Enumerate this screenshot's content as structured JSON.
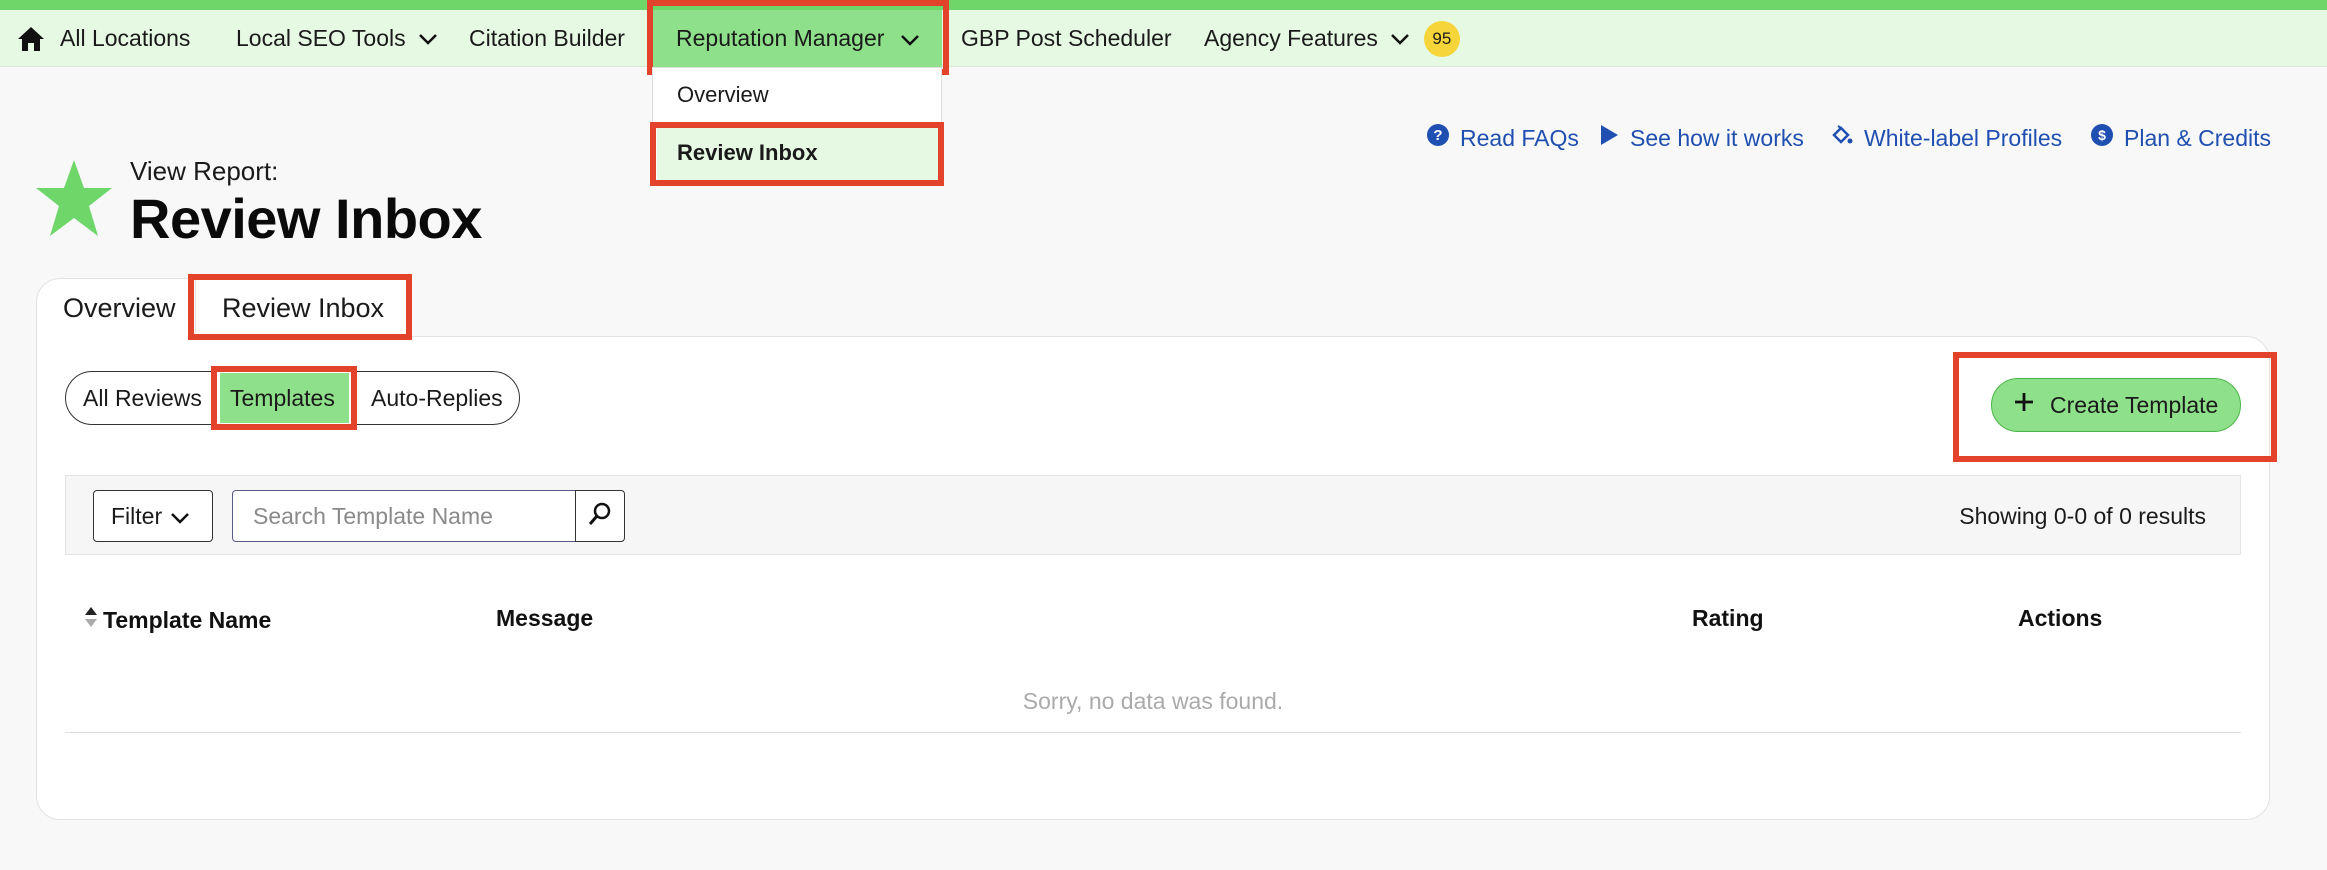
{
  "nav": {
    "home_label": "All Locations",
    "local_seo": "Local SEO Tools",
    "citation": "Citation Builder",
    "reputation": "Reputation Manager",
    "gbp": "GBP Post Scheduler",
    "agency": "Agency Features",
    "badge_count": "95"
  },
  "dropdown": {
    "items": [
      "Overview",
      "Review Inbox"
    ]
  },
  "help": {
    "faqs": "Read FAQs",
    "how": "See how it works",
    "whitelabel": "White-label Profiles",
    "plan": "Plan & Credits"
  },
  "header": {
    "subtitle": "View Report:",
    "title": "Review Inbox"
  },
  "tabs": [
    "Overview",
    "Review Inbox"
  ],
  "segments": [
    "All Reviews",
    "Templates",
    "Auto-Replies"
  ],
  "create_label": "Create Template",
  "toolbar": {
    "filter_label": "Filter",
    "search_placeholder": "Search Template Name",
    "result_text": "Showing 0-0 of 0 results"
  },
  "table": {
    "columns": [
      "Template Name",
      "Message",
      "Rating",
      "Actions"
    ],
    "empty": "Sorry, no data was found."
  },
  "colors": {
    "accent_green": "#8fe08a",
    "nav_bg": "#e6f9e3",
    "link_blue": "#1f4fb0",
    "highlight_red": "#e4432b",
    "badge_yellow": "#f5d53a"
  }
}
